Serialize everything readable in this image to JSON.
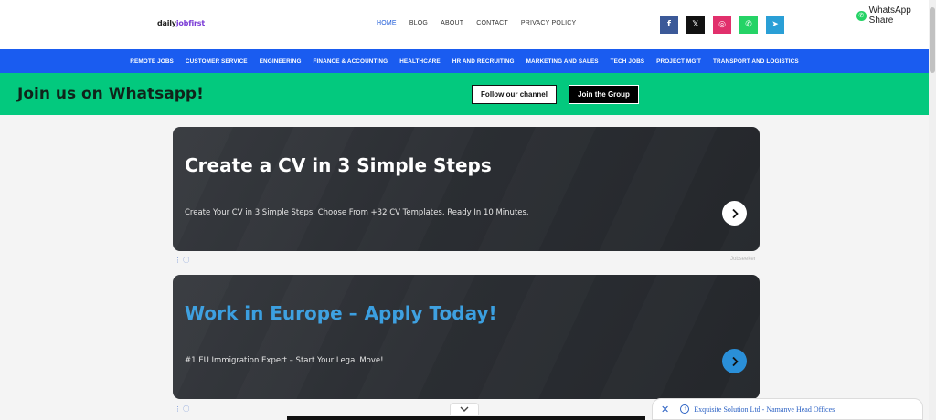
{
  "logo": {
    "prefix": "daily",
    "accent": "jobfirst"
  },
  "topnav": [
    "HOME",
    "BLOG",
    "ABOUT",
    "CONTACT",
    "PRIVACY POLICY"
  ],
  "social": [
    {
      "icon": "facebook-icon",
      "glyph": "f",
      "color": "#3b5998"
    },
    {
      "icon": "x-icon",
      "glyph": "𝕏",
      "color": "#111111"
    },
    {
      "icon": "instagram-icon",
      "glyph": "◎",
      "color": "#e1306c"
    },
    {
      "icon": "whatsapp-icon",
      "glyph": "✆",
      "color": "#25d366"
    },
    {
      "icon": "telegram-icon",
      "glyph": "➤",
      "color": "#2a9fd6"
    }
  ],
  "whatsapp_share": "WhatsApp Share",
  "categories": [
    "REMOTE JOBS",
    "CUSTOMER SERVICE",
    "ENGINEERING",
    "FINANCE & ACCOUNTING",
    "HEALTHCARE",
    "HR AND RECRUITING",
    "MARKETING AND SALES",
    "TECH JOBS",
    "PROJECT MG'T",
    "TRANSPORT AND LOGISTICS"
  ],
  "banner": {
    "title": "Join us on Whatsapp!",
    "follow_label": "Follow our channel",
    "join_label": "Join the Group"
  },
  "ads": [
    {
      "title": "Create a CV in 3 Simple Steps",
      "text": "Create Your CV in 3 Simple Steps. Choose From +32 CV Templates. Ready In 10 Minutes.",
      "source": "Jobseeker"
    },
    {
      "title": "Work in Europe – Apply Today!",
      "text": "#1 EU Immigration Expert – Start Your Legal Move!"
    }
  ],
  "notice": {
    "text": "Exquisite Solution Ltd - Namanve Head Offices"
  },
  "colors": {
    "primary": "#1a5cf0",
    "whatsapp": "#03c97e",
    "link": "#2c62c4"
  }
}
